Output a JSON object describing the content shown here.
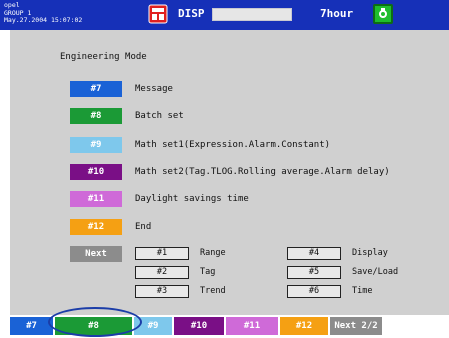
{
  "header": {
    "info_line1": "opel",
    "info_line2": "GROUP 1",
    "info_line3": "May.27.2004 15:07:02",
    "disp_label": "DISP",
    "hour_label": "7hour"
  },
  "mode_title": "Engineering Mode",
  "menu_items": [
    {
      "key": "#7",
      "label": "Message",
      "color": "#1a62d6"
    },
    {
      "key": "#8",
      "label": "Batch set",
      "color": "#1b9a36"
    },
    {
      "key": "#9",
      "label": "Math set1(Expression.Alarm.Constant)",
      "color": "#7ec8ec"
    },
    {
      "key": "#10",
      "label": "Math set2(Tag.TLOG.Rolling average.Alarm delay)",
      "color": "#7a0f86"
    },
    {
      "key": "#11",
      "label": "Daylight savings time",
      "color": "#cf6ad8"
    },
    {
      "key": "#12",
      "label": "End",
      "color": "#f5a013"
    }
  ],
  "next_key": {
    "label": "Next",
    "color": "#8c8c8c"
  },
  "next_items": [
    {
      "key": "#1",
      "label": "Range"
    },
    {
      "key": "#2",
      "label": "Tag"
    },
    {
      "key": "#3",
      "label": "Trend"
    },
    {
      "key": "#4",
      "label": "Display"
    },
    {
      "key": "#5",
      "label": "Save/Load"
    },
    {
      "key": "#6",
      "label": "Time"
    }
  ],
  "softkeys": [
    {
      "label": "#7",
      "color": "#1a62d6"
    },
    {
      "label": "#8",
      "color": "#1b9a36"
    },
    {
      "label": "#9",
      "color": "#7ec8ec"
    },
    {
      "label": "#10",
      "color": "#7a0f86"
    },
    {
      "label": "#11",
      "color": "#cf6ad8"
    },
    {
      "label": "#12",
      "color": "#f5a013"
    },
    {
      "label": "Next 2/2",
      "color": "#8c8c8c"
    }
  ],
  "icons": {
    "disp": "disp-icon",
    "status": "status-icon"
  }
}
